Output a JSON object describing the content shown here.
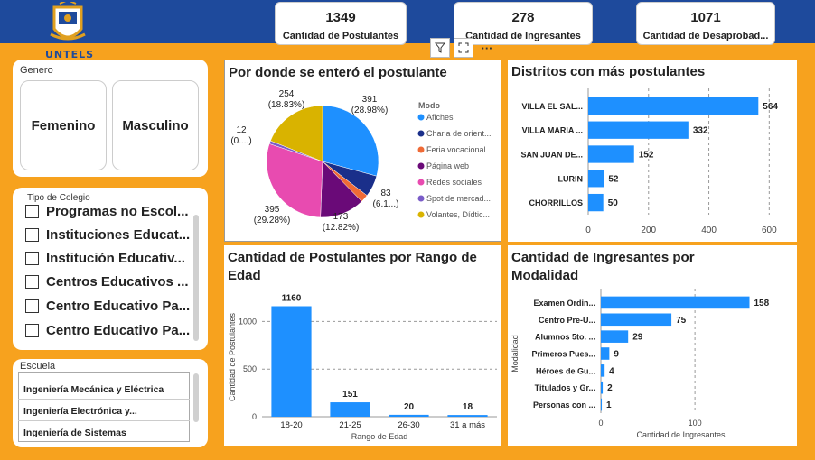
{
  "brand": {
    "logo_text": "UNTELS",
    "primary": "#1e4a9c",
    "background": "#f7a21e",
    "bar": "#1e90ff"
  },
  "kpis": [
    {
      "value": "1349",
      "label": "Cantidad de Postulantes"
    },
    {
      "value": "278",
      "label": "Cantidad de Ingresantes"
    },
    {
      "value": "1071",
      "label": "Cantidad de Desaprobad..."
    }
  ],
  "toolbar": {
    "filter_icon": "filter-icon",
    "focus_icon": "focus-mode-icon",
    "more_label": "···"
  },
  "genero": {
    "title": "Genero",
    "options": [
      "Femenino",
      "Masculino"
    ]
  },
  "tipo_colegio": {
    "title": "Tipo de Colegio",
    "items": [
      "Programas no Escol...",
      "Instituciones Educat...",
      "Institución Educativ...",
      "Centros Educativos ...",
      "Centro Educativo Pa...",
      "Centro Educativo Pa..."
    ]
  },
  "escuela": {
    "title": "Escuela",
    "items": [
      "Ingeniería Mecánica y Eléctrica",
      "Ingeniería Electrónica y...",
      "Ingeniería de Sistemas"
    ]
  },
  "chart_data": [
    {
      "type": "pie",
      "title": "Por donde se enteró el postulante",
      "legend_title": "Modo",
      "legend_position": "right",
      "slices": [
        {
          "name": "Afiches",
          "value": 391,
          "label": "391",
          "pct": "(28.98%)",
          "color": "#1e90ff"
        },
        {
          "name": "Charla de orient...",
          "value": 83,
          "label": "83",
          "pct": "(6.1...)",
          "color": "#1a2f8a"
        },
        {
          "name": "Feria vocacional",
          "value": 30,
          "label": "",
          "pct": "",
          "color": "#ef6a36"
        },
        {
          "name": "Página web",
          "value": 173,
          "label": "173",
          "pct": "(12.82%)",
          "color": "#6a0a78"
        },
        {
          "name": "Redes sociales",
          "value": 395,
          "label": "395",
          "pct": "(29.28%)",
          "color": "#e84bb0"
        },
        {
          "name": "Spot de mercad...",
          "value": 12,
          "label": "12",
          "pct": "(0....)",
          "color": "#7a5cc8"
        },
        {
          "name": "Volantes, Dídtic...",
          "value": 254,
          "label": "254",
          "pct": "(18.83%)",
          "color": "#d9b300"
        }
      ]
    },
    {
      "type": "bar",
      "orientation": "horizontal",
      "title": "Distritos con más postulantes",
      "categories": [
        "VILLA EL SAL...",
        "VILLA MARIA ...",
        "SAN JUAN DE...",
        "LURIN",
        "CHORRILLOS"
      ],
      "values": [
        564,
        332,
        152,
        52,
        50
      ],
      "xlim": [
        0,
        620
      ],
      "xticks": [
        0,
        200,
        400,
        600
      ],
      "grid": true
    },
    {
      "type": "bar",
      "orientation": "vertical",
      "title": "Cantidad de Postulantes por Rango de Edad",
      "categories": [
        "18-20",
        "21-25",
        "26-30",
        "31 a más"
      ],
      "values": [
        1160,
        151,
        20,
        18
      ],
      "xlabel": "Rango de Edad",
      "ylabel": "Cantidad de Postulantes",
      "ylim": [
        0,
        1250
      ],
      "yticks": [
        0,
        500,
        1000
      ],
      "grid": true
    },
    {
      "type": "bar",
      "orientation": "horizontal",
      "title": "Cantidad de Ingresantes por Modalidad",
      "categories": [
        "Examen Ordin...",
        "Centro Pre-U...",
        "Alumnos 5to. ...",
        "Primeros Pues...",
        "Héroes de Gu...",
        "Titulados y Gr...",
        "Personas con ..."
      ],
      "values": [
        158,
        75,
        29,
        9,
        4,
        2,
        1
      ],
      "xlabel": "Cantidad de Ingresantes",
      "ylabel": "Modalidad",
      "xlim": [
        0,
        170
      ],
      "xticks": [
        0,
        100
      ],
      "grid": true
    }
  ]
}
